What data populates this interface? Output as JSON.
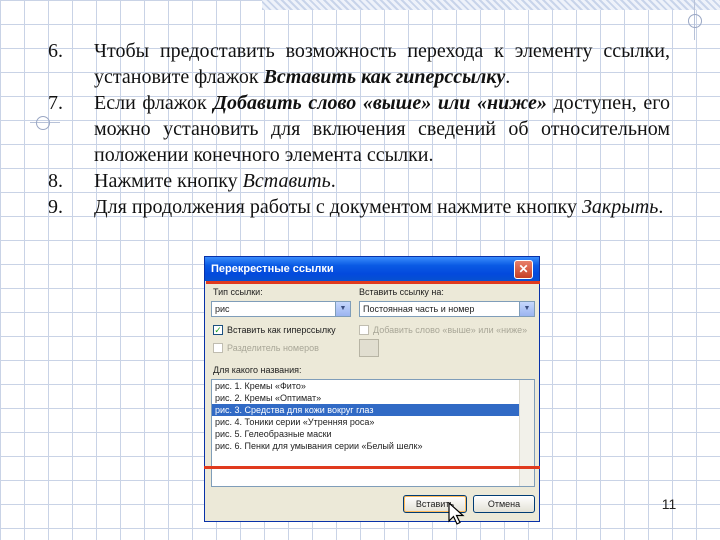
{
  "steps": [
    {
      "num": "6.",
      "parts": [
        "Чтобы предоставить возможность перехода к элементу ссылки, установите флажок ",
        "Вставить как гиперссылку",
        "."
      ]
    },
    {
      "num": "7.",
      "parts": [
        "Если флажок ",
        "Добавить слово «выше» или «ниже»",
        " доступен, его можно установить для включения сведений об относительном положении конечного элемента ссылки."
      ]
    },
    {
      "num": "8.",
      "parts": [
        "Нажмите кнопку ",
        "Вставить",
        "."
      ]
    },
    {
      "num": "9.",
      "parts": [
        "Для продолжения работы с документом нажмите кнопку ",
        "Закрыть",
        "."
      ]
    }
  ],
  "dialog": {
    "title": "Перекрестные ссылки",
    "close_glyph": "✕",
    "ref_type_label": "Тип ссылки:",
    "ref_type_value": "рис",
    "insert_ref_label": "Вставить ссылку на:",
    "insert_ref_value": "Постоянная часть и номер",
    "hyperlink_checkbox": {
      "label": "Вставить как гиперссылку",
      "checked": true
    },
    "above_below_checkbox": {
      "label": "Добавить слово «выше» или «ниже»",
      "checked": false,
      "disabled": true
    },
    "separator_checkbox": {
      "label": "Разделитель номеров",
      "checked": false,
      "disabled": true
    },
    "which_caption_label": "Для какого названия:",
    "captions": [
      "рис. 1. Кремы «Фито»",
      "рис. 2. Кремы «Оптимат»",
      "рис. 3. Средства для кожи вокруг глаз",
      "рис. 4. Тоники серии «Утренняя роса»",
      "рис. 5. Гелеобразные маски",
      "рис. 6. Пенки для умывания серии «Белый шелк»"
    ],
    "selected_caption_index": 2,
    "insert_button": "Вставить",
    "cancel_button": "Отмена"
  },
  "page_number": "11",
  "colors": {
    "title_bar": "#0a5ae4",
    "selection": "#316ac5",
    "annotation_line": "#e03a1e",
    "grid": "#c9d3e6"
  }
}
